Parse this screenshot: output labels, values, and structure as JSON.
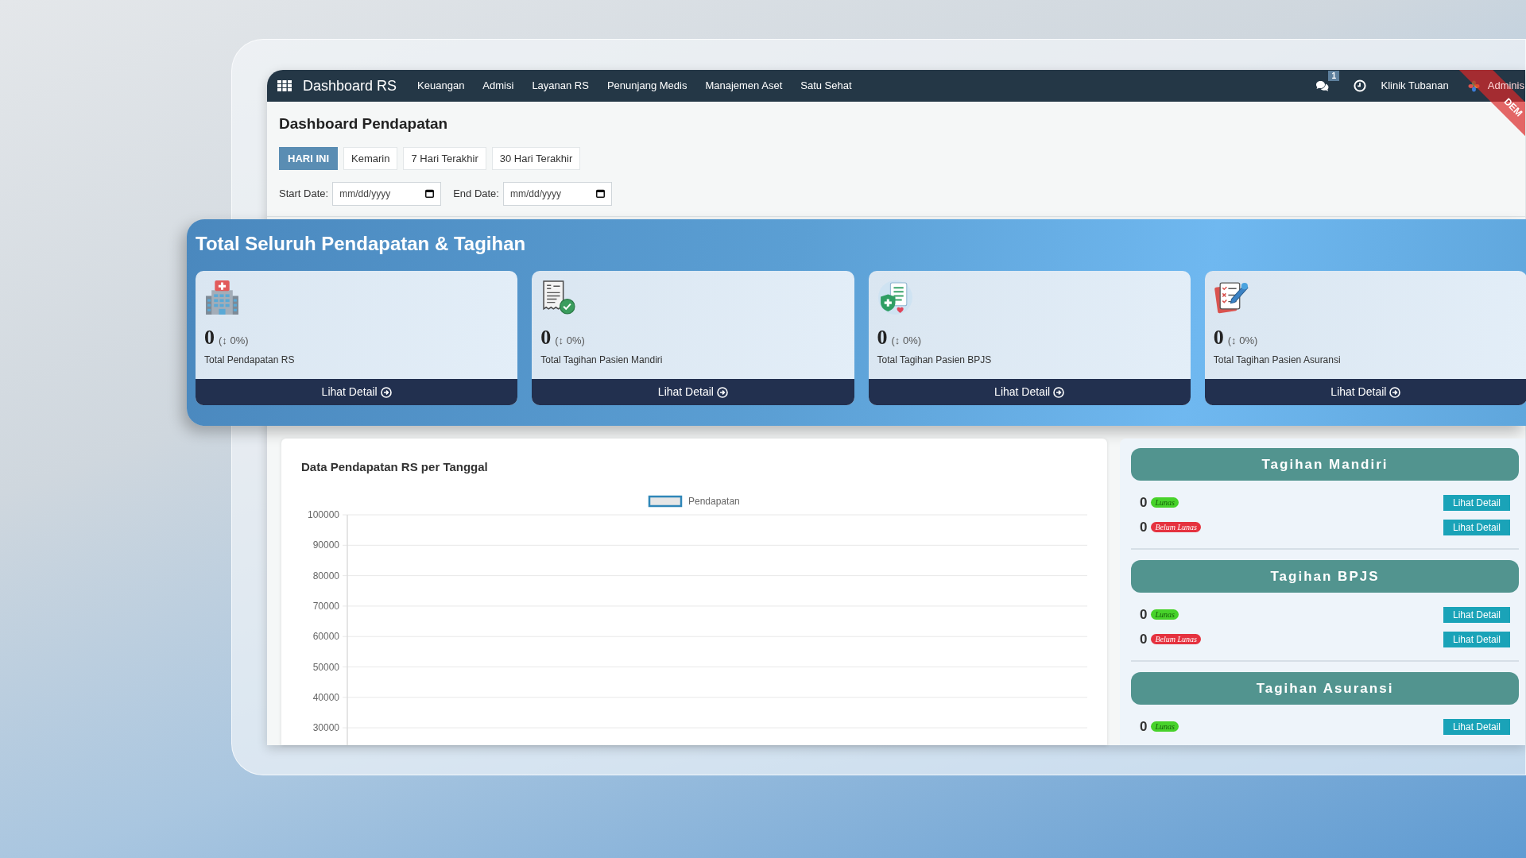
{
  "navbar": {
    "brand": "Dashboard RS",
    "menu": [
      "Keuangan",
      "Admisi",
      "Layanan RS",
      "Penunjang Medis",
      "Manajemen Aset",
      "Satu Sehat"
    ],
    "messages_badge": "1",
    "clinic": "Klinik Tubanan",
    "user": "Adminis",
    "ribbon": "DEM"
  },
  "page": {
    "title": "Dashboard Pendapatan",
    "tabs": [
      {
        "label": "HARI INI",
        "selected": true
      },
      {
        "label": "Kemarin",
        "selected": false
      },
      {
        "label": "7 Hari Terakhir",
        "selected": false
      },
      {
        "label": "30 Hari Terakhir",
        "selected": false
      }
    ],
    "filters": [
      {
        "label": "Start Date:",
        "placeholder": "mm/dd/yyyy"
      },
      {
        "label": "End Date:",
        "placeholder": "mm/dd/yyyy"
      }
    ]
  },
  "summary": {
    "title": "Total Seluruh Pendapatan & Tagihan",
    "cards": [
      {
        "kind": "hospital",
        "value": "0",
        "change": "(↕ 0%)",
        "label": "Total Pendapatan RS",
        "action": "Lihat Detail"
      },
      {
        "kind": "receipt",
        "value": "0",
        "change": "(↕ 0%)",
        "label": "Total Tagihan Pasien Mandiri",
        "action": "Lihat Detail"
      },
      {
        "kind": "bpjs",
        "value": "0",
        "change": "(↕ 0%)",
        "label": "Total Tagihan Pasien BPJS",
        "action": "Lihat Detail"
      },
      {
        "kind": "insurance",
        "value": "0",
        "change": "(↕ 0%)",
        "label": "Total Tagihan Pasien Asuransi",
        "action": "Lihat Detail"
      }
    ]
  },
  "revenue_chart": {
    "chart_data": {
      "type": "bar",
      "title": "Data Pendapatan RS per Tanggal",
      "series": [
        {
          "name": "Pendapatan",
          "color": "#2f86b8"
        }
      ],
      "ylim": [
        24000,
        100000
      ],
      "yticks": [
        100000,
        90000,
        80000,
        70000,
        60000,
        50000,
        40000,
        30000
      ],
      "grid": true
    }
  },
  "billing_panel": {
    "sections": [
      {
        "title": "Tagihan Mandiri",
        "rows": [
          {
            "count": "0",
            "kind": "paid",
            "status": "Lunas",
            "action": "Lihat Detail"
          },
          {
            "count": "0",
            "kind": "unpaid",
            "status": "Belum Lunas",
            "action": "Lihat Detail"
          }
        ]
      },
      {
        "title": "Tagihan BPJS",
        "rows": [
          {
            "count": "0",
            "kind": "paid",
            "status": "Lunas",
            "action": "Lihat Detail"
          },
          {
            "count": "0",
            "kind": "unpaid",
            "status": "Belum Lunas",
            "action": "Lihat Detail"
          }
        ]
      },
      {
        "title": "Tagihan Asuransi",
        "rows": [
          {
            "count": "0",
            "kind": "paid",
            "status": "Lunas",
            "action": "Lihat Detail"
          }
        ]
      }
    ]
  }
}
